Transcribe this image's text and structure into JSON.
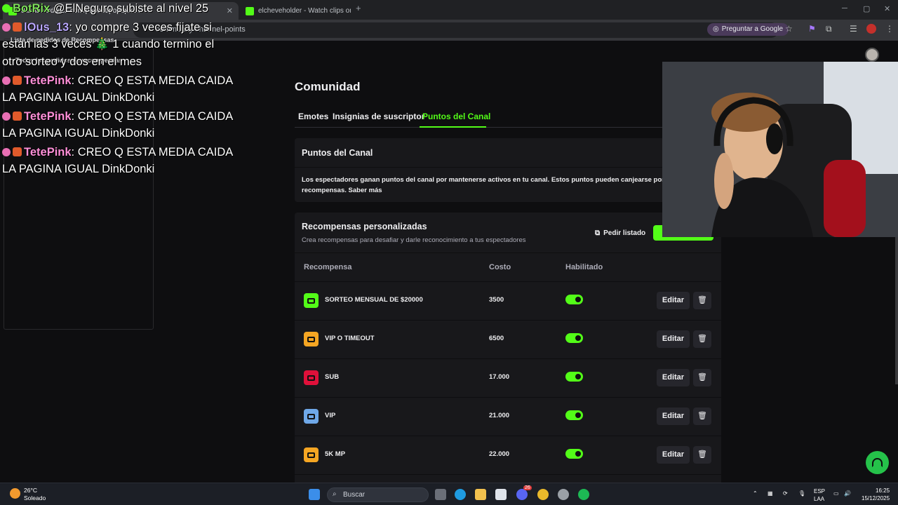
{
  "browser": {
    "tabs": [
      {
        "label": "dashboard.kick.com/popout/popup/re..."
      },
      {
        "label": "elcheveholder - Watch clips on..."
      }
    ],
    "new_tab": "+",
    "url": "dashboard.kick.com/popout/popup/re...",
    "url_right": "community/channel-points",
    "ask_google": "Preguntar a Google"
  },
  "community": {
    "title": "Comunidad",
    "tabs": [
      "Emotes",
      "Insignias de suscriptor",
      "Puntos del Canal"
    ],
    "info_title": "Puntos del Canal",
    "info_text": "Los espectadores ganan puntos del canal por mantenerse activos en tu canal. Estos puntos pueden canjearse por recompensas. Saber más"
  },
  "rewards": {
    "title": "Recompensas personalizadas",
    "subtitle": "Crea recompensas para desafiar y darle reconocimiento a tus espectadores",
    "request_button": "Pedir listado",
    "columns": [
      "Recompensa",
      "Costo",
      "Habilitado"
    ],
    "edit_label": "Editar",
    "items": [
      {
        "name": "SORTEO MENSUAL DE $20000",
        "cost": "3500",
        "color": "#53fc18",
        "enabled": true
      },
      {
        "name": "VIP O TIMEOUT",
        "cost": "6500",
        "color": "#f5a623",
        "enabled": true
      },
      {
        "name": "SUB",
        "cost": "17.000",
        "color": "#e0103a",
        "enabled": true
      },
      {
        "name": "VIP",
        "cost": "21.000",
        "color": "#6fa8e8",
        "enabled": true
      },
      {
        "name": "5K MP",
        "cost": "22.000",
        "color": "#f5a623",
        "enabled": true
      }
    ]
  },
  "popout": {
    "queue_title": "Lista de pedidos de Recompensas",
    "queue_filter": "Todos los pedidos de recompensas"
  },
  "chat": [
    {
      "user": "BotRix",
      "user_color": "#7ee05a",
      "text": "@ElNeguro subiste al nivel 25"
    },
    {
      "user": "lOus_13",
      "user_color": "#b9a7ff",
      "text": ": yo compre 3 veces fijate si"
    },
    {
      "user": "",
      "user_color": "#ffffff",
      "text": "estan las 3 veces 🎄 1 cuando termino el"
    },
    {
      "user": "",
      "user_color": "#ffffff",
      "text": "otro sorteo y dos en el mes"
    },
    {
      "user": "TetePink",
      "user_color": "#ff8fd8",
      "text": ": CREO Q ESTA MEDIA CAIDA"
    },
    {
      "user": "",
      "user_color": "#ffffff",
      "text": "LA PAGINA IGUAL DinkDonki"
    },
    {
      "user": "TetePink",
      "user_color": "#ff8fd8",
      "text": ": CREO Q ESTA MEDIA CAIDA"
    },
    {
      "user": "",
      "user_color": "#ffffff",
      "text": "LA PAGINA IGUAL DinkDonki"
    },
    {
      "user": "TetePink",
      "user_color": "#ff8fd8",
      "text": ": CREO Q ESTA MEDIA CAIDA"
    },
    {
      "user": "",
      "user_color": "#ffffff",
      "text": "LA PAGINA IGUAL DinkDonki"
    }
  ],
  "taskbar": {
    "weather_temp": "26°C",
    "weather_desc": "Soleado",
    "search_placeholder": "Buscar",
    "lang_top": "ESP",
    "lang_bottom": "LAA",
    "time": "16:25",
    "date": "15/12/2025",
    "discord_badge": "26"
  },
  "colors": {
    "accent": "#53fc18",
    "panel": "#18181b",
    "background": "#0e0e10"
  }
}
